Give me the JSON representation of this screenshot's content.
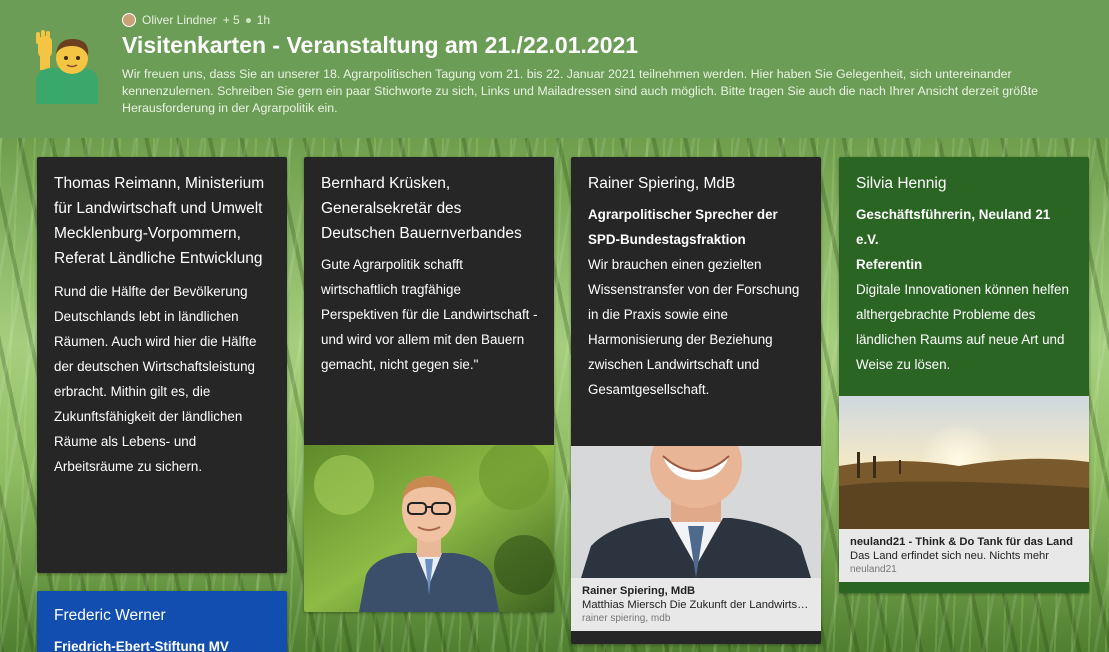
{
  "header": {
    "author": "Oliver Lindner",
    "collaborators": "+ 5",
    "time": "1h",
    "title": "Visitenkarten - Veranstaltung am 21./22.01.2021",
    "description": "Wir freuen uns, dass Sie an unserer 18. Agrarpolitischen Tagung vom 21. bis 22. Januar 2021 teilnehmen werden. Hier haben Sie Gelegenheit, sich untereinander kennenzulernen. Schreiben Sie gern ein paar Stichworte zu sich, Links und Mailadressen sind auch möglich. Bitte tragen Sie auch die nach Ihrer Ansicht derzeit größte Herausforderung in der Agrarpolitik ein.",
    "icon": "waving-person-icon"
  },
  "cards": {
    "reimann": {
      "name": "Thomas Reimann, Ministerium für Landwirtschaft und Umwelt Mecklenburg-Vorpommern, Referat Ländliche Entwicklung",
      "text": "Rund die Hälfte der Bevölkerung Deutschlands lebt in ländlichen Räumen. Auch wird hier die Hälfte der deutschen Wirtschaftsleistung erbracht. Mithin gilt es, die Zukunftsfähigkeit der ländlichen Räume als Lebens- und Arbeitsräume zu sichern."
    },
    "werner": {
      "name": "Frederic Werner",
      "subtitle": "Friedrich-Ebert-Stiftung MV"
    },
    "kruesken": {
      "name": "Bernhard Krüsken, Generalsekretär des Deutschen Bauernverbandes",
      "text": "Gute Agrarpolitik schafft wirtschaftlich tragfähige Perspektiven für die Landwirtschaft - und wird vor allem mit den Bauern gemacht, nicht gegen sie.\""
    },
    "spiering": {
      "name": "Rainer Spiering, MdB",
      "role": "Agrarpolitischer Sprecher der SPD-Bundestagsfraktion",
      "text": "Wir brauchen einen gezielten Wissenstransfer von der Forschung in die Praxis sowie eine Harmonisierung der Beziehung zwischen Landwirtschaft und Gesamtgesellschaft.",
      "link_title": "Rainer Spiering, MdB",
      "link_desc": "Matthias Miersch Die Zukunft der Landwirtschaft",
      "link_domain": "rainer spiering, mdb"
    },
    "hennig": {
      "name": "Silvia Hennig",
      "role": "Geschäftsführerin, Neuland 21 e.V.",
      "role2": "Referentin",
      "text": "Digitale Innovationen können helfen althergebrachte Probleme des ländlichen Raums auf neue Art und Weise zu lösen.",
      "link_title": "neuland21 - Think & Do Tank für das Land",
      "link_desc": "Das Land erfindet sich neu. Nichts mehr",
      "link_domain": "neuland21"
    }
  },
  "colors": {
    "header_bg": "#6b9d57",
    "card_dark": "#262626",
    "card_green": "#2a6523",
    "card_blue": "#114eb0"
  }
}
